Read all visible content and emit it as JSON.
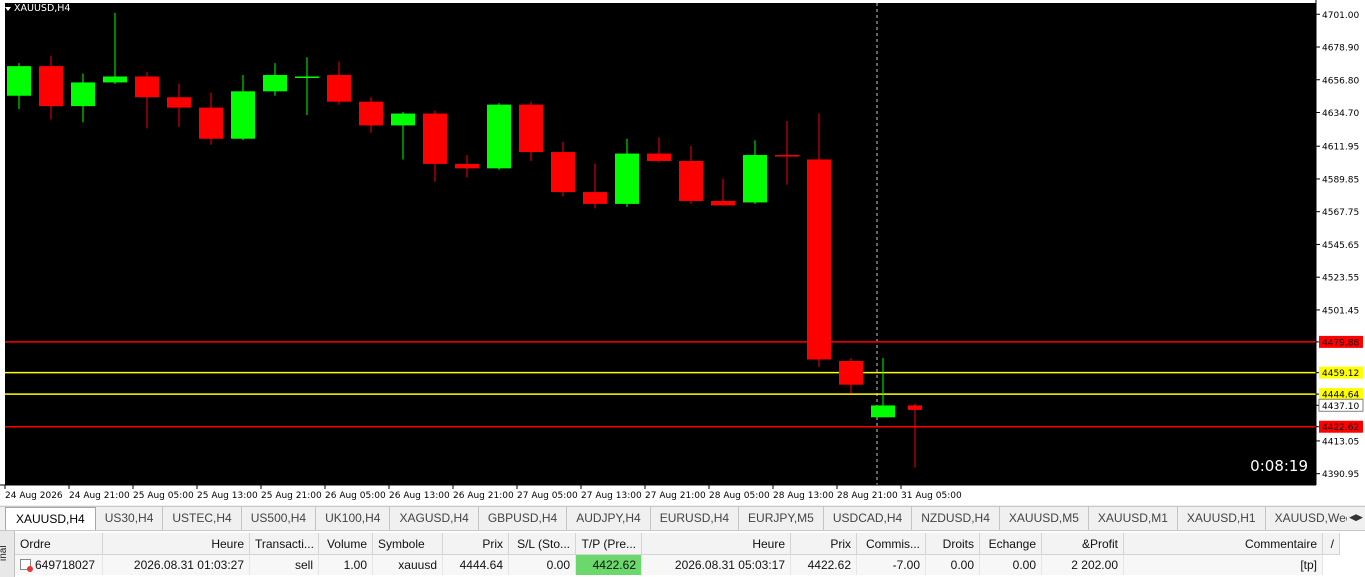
{
  "window": {
    "title": "XAUUSD,H4",
    "timer": "0:08:19"
  },
  "chart_data": {
    "type": "candlestick",
    "symbol": "XAUUSD",
    "timeframe": "H4",
    "ylim": [
      4383.3,
      4708.6
    ],
    "y_ticks": [
      "4701.00",
      "4678.90",
      "4656.80",
      "4634.70",
      "4611.95",
      "4589.85",
      "4567.75",
      "4545.65",
      "4523.55",
      "4501.45",
      "4479.88",
      "4459.12",
      "4444.64",
      "4437.10",
      "4422.62",
      "4413.05",
      "4390.95"
    ],
    "x_ticks": [
      "24 Aug 2026",
      "24 Aug 21:00",
      "25 Aug 05:00",
      "25 Aug 13:00",
      "25 Aug 21:00",
      "26 Aug 05:00",
      "26 Aug 13:00",
      "26 Aug 21:00",
      "27 Aug 05:00",
      "27 Aug 13:00",
      "27 Aug 21:00",
      "28 Aug 05:00",
      "28 Aug 13:00",
      "28 Aug 21:00",
      "31 Aug 05:00"
    ],
    "candles": [
      {
        "o": 4646.0,
        "h": 4668.0,
        "l": 4637.0,
        "c": 4666.0
      },
      {
        "o": 4666.0,
        "h": 4673.0,
        "l": 4630.0,
        "c": 4639.0
      },
      {
        "o": 4639.0,
        "h": 4661.0,
        "l": 4628.0,
        "c": 4655.0
      },
      {
        "o": 4655.0,
        "h": 4702.0,
        "l": 4654.0,
        "c": 4659.0
      },
      {
        "o": 4659.0,
        "h": 4662.0,
        "l": 4624.0,
        "c": 4645.0
      },
      {
        "o": 4645.0,
        "h": 4654.0,
        "l": 4625.0,
        "c": 4638.0
      },
      {
        "o": 4638.0,
        "h": 4648.0,
        "l": 4613.0,
        "c": 4617.0
      },
      {
        "o": 4617.0,
        "h": 4660.0,
        "l": 4616.0,
        "c": 4649.0
      },
      {
        "o": 4649.0,
        "h": 4668.0,
        "l": 4646.0,
        "c": 4660.0
      },
      {
        "o": 4659.0,
        "h": 4672.0,
        "l": 4633.0,
        "c": 4659.0
      },
      {
        "o": 4660.0,
        "h": 4669.0,
        "l": 4640.0,
        "c": 4642.0
      },
      {
        "o": 4642.0,
        "h": 4645.0,
        "l": 4621.0,
        "c": 4626.0
      },
      {
        "o": 4626.0,
        "h": 4635.0,
        "l": 4603.0,
        "c": 4634.0
      },
      {
        "o": 4634.0,
        "h": 4636.0,
        "l": 4588.0,
        "c": 4600.0
      },
      {
        "o": 4600.0,
        "h": 4606.0,
        "l": 4591.0,
        "c": 4597.0
      },
      {
        "o": 4597.0,
        "h": 4641.0,
        "l": 4596.0,
        "c": 4640.0
      },
      {
        "o": 4640.0,
        "h": 4642.0,
        "l": 4602.0,
        "c": 4608.0
      },
      {
        "o": 4608.0,
        "h": 4615.0,
        "l": 4578.0,
        "c": 4581.0
      },
      {
        "o": 4581.0,
        "h": 4600.0,
        "l": 4570.0,
        "c": 4573.0
      },
      {
        "o": 4573.0,
        "h": 4617.0,
        "l": 4571.0,
        "c": 4607.0
      },
      {
        "o": 4607.0,
        "h": 4618.0,
        "l": 4601.0,
        "c": 4602.0
      },
      {
        "o": 4602.0,
        "h": 4612.0,
        "l": 4573.0,
        "c": 4575.0
      },
      {
        "o": 4575.0,
        "h": 4590.0,
        "l": 4573.0,
        "c": 4572.0
      },
      {
        "o": 4574.0,
        "h": 4616.0,
        "l": 4573.0,
        "c": 4606.0
      },
      {
        "o": 4606.0,
        "h": 4629.0,
        "l": 4586.0,
        "c": 4605.0
      },
      {
        "o": 4603.0,
        "h": 4634.0,
        "l": 4463.0,
        "c": 4468.0
      },
      {
        "o": 4467.0,
        "h": 4469.0,
        "l": 4445.0,
        "c": 4451.0
      },
      {
        "o": 4429.0,
        "h": 4469.0,
        "l": 4429.0,
        "c": 4437.0
      },
      {
        "o": 4437.0,
        "h": 4438.0,
        "l": 4395.0,
        "c": 4434.0
      }
    ],
    "levels": [
      {
        "price": 4479.88,
        "label": "4479.88",
        "color": "#ff0000"
      },
      {
        "price": 4459.12,
        "label": "4459.12",
        "color": "#ffff00"
      },
      {
        "price": 4444.64,
        "label": "4444.64",
        "color": "#ffff00"
      },
      {
        "price": 4422.62,
        "label": "4422.62",
        "color": "#ff0000"
      }
    ],
    "current_price": {
      "price": 4437.1,
      "label": "4437.10"
    },
    "grid": false,
    "colors": {
      "bull": "#00ff00",
      "bear": "#ff0000",
      "background": "#000000",
      "axis_text": "#000000"
    }
  },
  "tabs": [
    "XAUUSD,H4",
    "US30,H4",
    "USTEC,H4",
    "US500,H4",
    "UK100,H4",
    "XAGUSD,H4",
    "GBPUSD,H4",
    "AUDJPY,H4",
    "EURUSD,H4",
    "EURJPY,M5",
    "USDCAD,H4",
    "NZDUSD,H4",
    "XAUUSD,M5",
    "XAUUSD,M1",
    "XAUUSD,H1",
    "XAUUSD,Weekly"
  ],
  "active_tab": 0,
  "terminal": {
    "side_label": "inal",
    "columns": [
      "Ordre",
      "Heure",
      "Transacti...",
      "Volume",
      "Symbole",
      "Prix",
      "S/L (Sto...",
      "T/P (Pre...",
      "Heure",
      "Prix",
      "Commis...",
      "Droits",
      "Echange",
      "&Profit",
      "Commentaire",
      "/"
    ],
    "rows": [
      [
        "649718027",
        "2026.08.31 01:03:27",
        "sell",
        "1.00",
        "xauusd",
        "4444.64",
        "0.00",
        "4422.62",
        "2026.08.31 05:03:17",
        "4422.62",
        "-7.00",
        "0.00",
        "0.00",
        "2 202.00",
        "[tp]"
      ]
    ]
  }
}
